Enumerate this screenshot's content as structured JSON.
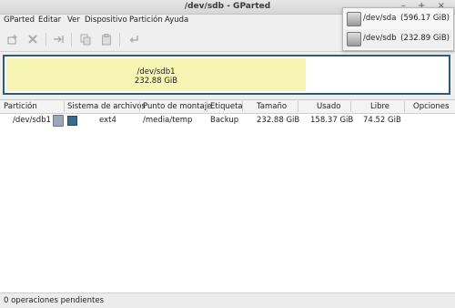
{
  "window": {
    "title": "/dev/sdb - GParted",
    "buttons": "– + ×"
  },
  "menu": [
    "GParted",
    "Editar",
    "Ver",
    "Dispositivo",
    "Partición",
    "Ayuda"
  ],
  "toolbar": {
    "icons": [
      "new-icon",
      "delete-icon",
      "resize-move-icon",
      "copy-icon",
      "paste-icon",
      "undo-icon"
    ]
  },
  "devices": [
    {
      "name": "/dev/sda",
      "size": "(596.17 GiB)"
    },
    {
      "name": "/dev/sdb",
      "size": "(232.89 GiB)"
    }
  ],
  "partition_map": {
    "name": "/dev/sdb1",
    "size": "232.88 GiB",
    "used_fraction": 0.68,
    "fill_color": "#f6f5b3",
    "border_color": "#2f5b78"
  },
  "table": {
    "headers": [
      "Partición",
      "Sistema de archivos",
      "Punto de montaje",
      "Etiqueta",
      "Tamaño",
      "Usado",
      "Libre",
      "Opciones"
    ],
    "rows": [
      {
        "partition": "/dev/sdb1",
        "filesystem": "ext4",
        "mount": "/media/temp",
        "label": "Backup",
        "size": "232.88 GiB",
        "used": "158.37 GiB",
        "free": "74.52 GiB",
        "options": "",
        "fs_color": "#3c6a8e"
      }
    ]
  },
  "status": "0 operaciones pendientes"
}
